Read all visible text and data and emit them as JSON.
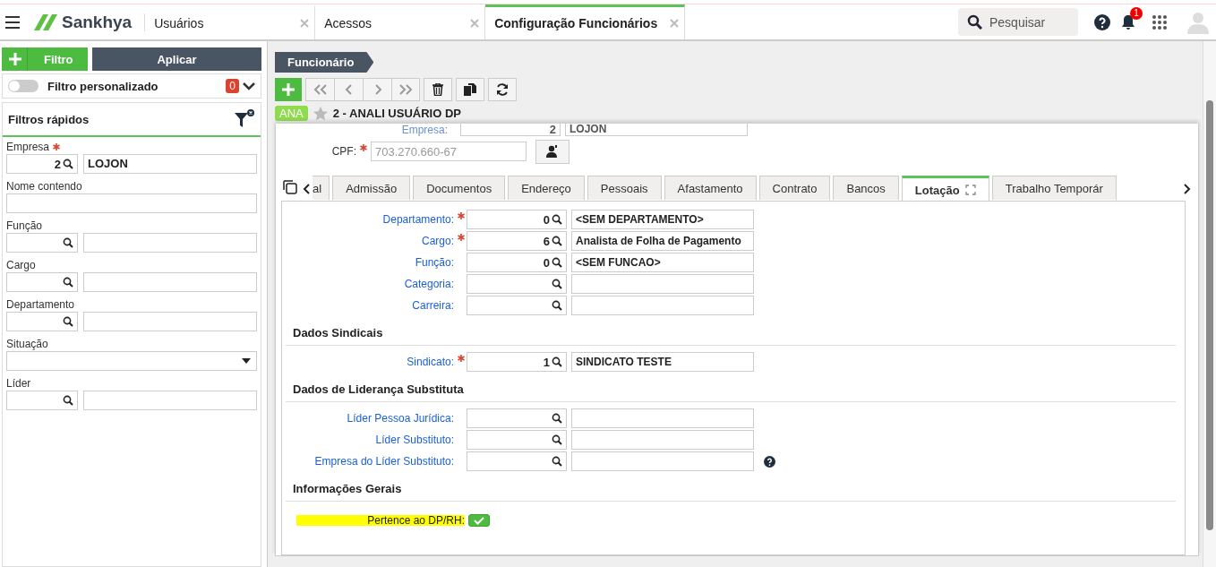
{
  "topbar": {
    "brand": "Sankhya",
    "tabs": [
      {
        "label": "Usuários",
        "selected": false
      },
      {
        "label": "Acessos",
        "selected": false
      },
      {
        "label": "Configuração Funcionários",
        "selected": true
      }
    ],
    "search": {
      "placeholder": "Pesquisar"
    },
    "notification_count": "1"
  },
  "filter_panel": {
    "add_label": "Filtro",
    "apply_label": "Aplicar",
    "custom_filter": {
      "label": "Filtro personalizado",
      "on": false,
      "count": "0"
    },
    "quick_title": "Filtros rápidos",
    "fields": [
      {
        "kind": "lookup",
        "label": "Empresa",
        "required": true,
        "code": "2",
        "description": "LOJON"
      },
      {
        "kind": "text",
        "label": "Nome contendo"
      },
      {
        "kind": "lookup",
        "label": "Função"
      },
      {
        "kind": "lookup",
        "label": "Cargo"
      },
      {
        "kind": "lookup",
        "label": "Departamento"
      },
      {
        "kind": "select",
        "label": "Situação"
      },
      {
        "kind": "lookup",
        "label": "Líder"
      }
    ]
  },
  "main": {
    "breadcrumb": "Funcionário",
    "record": {
      "tag": "ANA",
      "title": "2 - ANALI USUÁRIO DP",
      "favorite": false
    },
    "header_fields": [
      {
        "label": "Empresa:",
        "code": "2",
        "value": "LOJON"
      }
    ],
    "cpf": {
      "label": "CPF:",
      "required": true,
      "value": "703.270.660-67"
    },
    "tabs": [
      {
        "label": "al",
        "selected": false
      },
      {
        "label": "Admissão",
        "selected": false
      },
      {
        "label": "Documentos",
        "selected": false
      },
      {
        "label": "Endereço",
        "selected": false
      },
      {
        "label": "Pessoais",
        "selected": false
      },
      {
        "label": "Afastamento",
        "selected": false
      },
      {
        "label": "Contrato",
        "selected": false
      },
      {
        "label": "Bancos",
        "selected": false
      },
      {
        "label": "Lotação",
        "selected": true
      },
      {
        "label": "Trabalho Temporár",
        "selected": false
      }
    ],
    "sections": [
      {
        "fields": [
          {
            "label": "Departamento:",
            "required": true,
            "code": "0",
            "value": "<SEM DEPARTAMENTO>"
          },
          {
            "label": "Cargo:",
            "required": true,
            "code": "6",
            "value": "Analista de Folha de Pagamento"
          },
          {
            "label": "Função:",
            "code": "0",
            "value": "<SEM FUNCAO>"
          },
          {
            "label": "Categoria:"
          },
          {
            "label": "Carreira:"
          }
        ]
      },
      {
        "title": "Dados Sindicais",
        "fields": [
          {
            "label": "Sindicato:",
            "required": true,
            "code": "1",
            "value": "SINDICATO TESTE"
          }
        ]
      },
      {
        "title": "Dados de Liderança Substituta",
        "fields": [
          {
            "label": "Líder Pessoa Jurídica:"
          },
          {
            "label": "Líder Substituto:"
          },
          {
            "label": "Empresa do Líder Substituto:",
            "help": true
          }
        ]
      },
      {
        "title": "Informações Gerais"
      }
    ],
    "flag": {
      "label": "Pertence ao DP/RH:",
      "checked": true,
      "highlighted": true
    }
  }
}
